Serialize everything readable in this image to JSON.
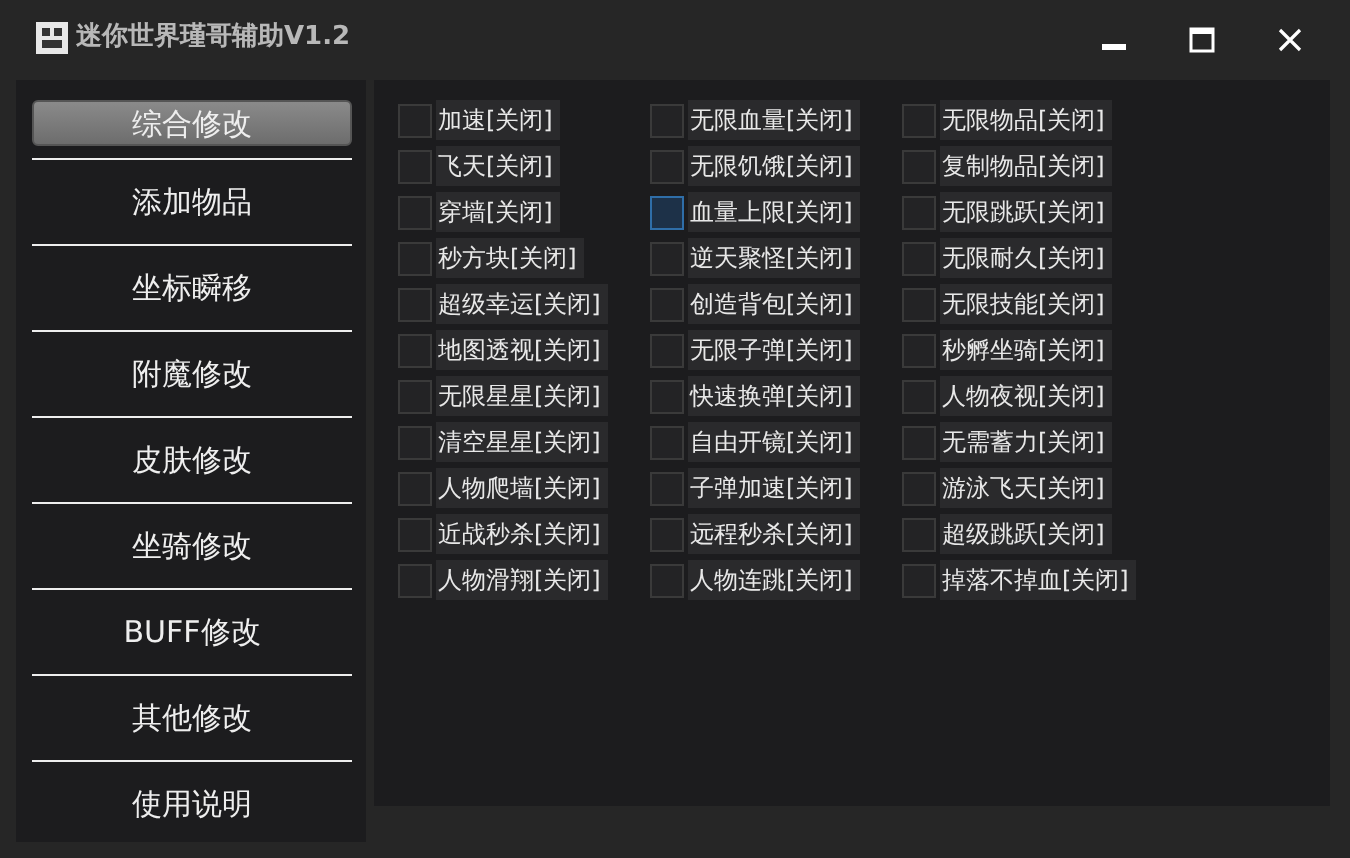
{
  "window": {
    "title": "迷你世界瑾哥辅助V1.2"
  },
  "sidebar": {
    "items": [
      {
        "label": "综合修改",
        "selected": true
      },
      {
        "label": "添加物品",
        "selected": false
      },
      {
        "label": "坐标瞬移",
        "selected": false
      },
      {
        "label": "附魔修改",
        "selected": false
      },
      {
        "label": "皮肤修改",
        "selected": false
      },
      {
        "label": "坐骑修改",
        "selected": false
      },
      {
        "label": "BUFF修改",
        "selected": false
      },
      {
        "label": "其他修改",
        "selected": false
      },
      {
        "label": "使用说明",
        "selected": false
      }
    ]
  },
  "options": [
    {
      "label": "加速[关闭]",
      "checked": false,
      "focused": false
    },
    {
      "label": "无限血量[关闭]",
      "checked": false,
      "focused": false
    },
    {
      "label": "无限物品[关闭]",
      "checked": false,
      "focused": false
    },
    {
      "label": "飞天[关闭]",
      "checked": false,
      "focused": false
    },
    {
      "label": "无限饥饿[关闭]",
      "checked": false,
      "focused": false
    },
    {
      "label": "复制物品[关闭]",
      "checked": false,
      "focused": false
    },
    {
      "label": "穿墙[关闭]",
      "checked": false,
      "focused": false
    },
    {
      "label": "血量上限[关闭]",
      "checked": false,
      "focused": true
    },
    {
      "label": "无限跳跃[关闭]",
      "checked": false,
      "focused": false
    },
    {
      "label": "秒方块[关闭]",
      "checked": false,
      "focused": false
    },
    {
      "label": "逆天聚怪[关闭]",
      "checked": false,
      "focused": false
    },
    {
      "label": "无限耐久[关闭]",
      "checked": false,
      "focused": false
    },
    {
      "label": "超级幸运[关闭]",
      "checked": false,
      "focused": false
    },
    {
      "label": "创造背包[关闭]",
      "checked": false,
      "focused": false
    },
    {
      "label": "无限技能[关闭]",
      "checked": false,
      "focused": false
    },
    {
      "label": "地图透视[关闭]",
      "checked": false,
      "focused": false
    },
    {
      "label": "无限子弹[关闭]",
      "checked": false,
      "focused": false
    },
    {
      "label": "秒孵坐骑[关闭]",
      "checked": false,
      "focused": false
    },
    {
      "label": "无限星星[关闭]",
      "checked": false,
      "focused": false
    },
    {
      "label": "快速换弹[关闭]",
      "checked": false,
      "focused": false
    },
    {
      "label": "人物夜视[关闭]",
      "checked": false,
      "focused": false
    },
    {
      "label": "清空星星[关闭]",
      "checked": false,
      "focused": false
    },
    {
      "label": "自由开镜[关闭]",
      "checked": false,
      "focused": false
    },
    {
      "label": "无需蓄力[关闭]",
      "checked": false,
      "focused": false
    },
    {
      "label": "人物爬墙[关闭]",
      "checked": false,
      "focused": false
    },
    {
      "label": "子弹加速[关闭]",
      "checked": false,
      "focused": false
    },
    {
      "label": "游泳飞天[关闭]",
      "checked": false,
      "focused": false
    },
    {
      "label": "近战秒杀[关闭]",
      "checked": false,
      "focused": false
    },
    {
      "label": "远程秒杀[关闭]",
      "checked": false,
      "focused": false
    },
    {
      "label": "超级跳跃[关闭]",
      "checked": false,
      "focused": false
    },
    {
      "label": "人物滑翔[关闭]",
      "checked": false,
      "focused": false
    },
    {
      "label": "人物连跳[关闭]",
      "checked": false,
      "focused": false
    },
    {
      "label": "掉落不掉血[关闭]",
      "checked": false,
      "focused": false
    }
  ]
}
